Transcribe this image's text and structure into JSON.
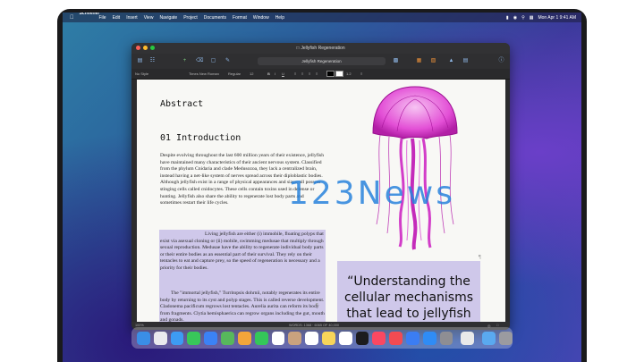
{
  "menubar": {
    "app_name": "Scrivener",
    "items": [
      "File",
      "Edit",
      "Insert",
      "View",
      "Navigate",
      "Project",
      "Documents",
      "Format",
      "Window",
      "Help"
    ],
    "clock": "Mon Apr 1  9:41 AM"
  },
  "window": {
    "title": "Jellyfish Regeneration",
    "document_field": "Jellyfish Regeneration",
    "traffic_lights": [
      "#ff5f57",
      "#febc2e",
      "#28c840"
    ]
  },
  "formatbar": {
    "style": "No Style",
    "font_family": "Times New Roman",
    "font_weight": "Regular",
    "font_size": "12",
    "line_spacing": "1.2"
  },
  "document": {
    "heading_abstract": "Abstract",
    "heading_intro": "01 Introduction",
    "paragraph1": "Despite evolving throughout the last 600 million years of their existence, jellyfish have maintained many characteristics of their ancient nervous system. Classified from the phylum Cnidaria and clade Medusozoa, they lack a centralized brain, instead having a net-like system of nerves spread across their diploblastic bodies. Although jellyfish exist in a range of physical appearances and sizes, all possess stinging cells called cnidocytes. These cells contain toxins used in defense or hunting. Jellyfish also share the ability to regenerate lost body parts and sometimes restart their life cycles.",
    "paragraph2": "Living jellyfish are either (i) immobile, floating polyps that exist via asexual cloning or (ii) mobile, swimming medusae that multiply through sexual reproduction. Medusae have the ability to regenerate individual body parts or their entire bodies as an essential part of their survival. They rely on their tentacles to eat and capture prey, so the speed of regeneration is necessary and a priority for their bodies.",
    "paragraph3": "The \"immortal jellyfish,\" Turritopsis dohrnii, notably regenerates its entire body by returning to its cyst and polyp stages. This is called reverse development. Cladonema pacificum regrows lost tentacles. Aurelia aurita can reform its body from fragments. Clytia hemisphaerica can regrow organs including the gut, mouth and gonads.",
    "pull_quote": "“Understanding the cellular mechanisms that lead to jellyfish regeneration may"
  },
  "statusbar": {
    "zoom": "100%",
    "word_count": "WORDS: 1368 · 6065 OF 40,000"
  },
  "watermark": "123News",
  "dock": {
    "apps": [
      "finder",
      "launchpad",
      "safari",
      "messages",
      "mail",
      "maps",
      "photos",
      "facetime",
      "calendar",
      "contacts",
      "reminders",
      "notes",
      "freeform",
      "tv",
      "music",
      "news",
      "keynote",
      "app-store",
      "system-settings",
      "scrivener",
      "downloads",
      "trash"
    ],
    "colors": [
      "#3a8ee6",
      "#e9e9ee",
      "#3d9bf3",
      "#38c75a",
      "#3b82f6",
      "#57b85c",
      "#f3a53b",
      "#34c759",
      "#ffffff",
      "#c9a27e",
      "#ffffff",
      "#f7d55a",
      "#ffffff",
      "#1c1c1e",
      "#fa4862",
      "#f24b52",
      "#3b7df3",
      "#2f8cf5",
      "#8e8e93",
      "#e9e9e9",
      "#5aa9f0",
      "#9b9ba0"
    ]
  }
}
